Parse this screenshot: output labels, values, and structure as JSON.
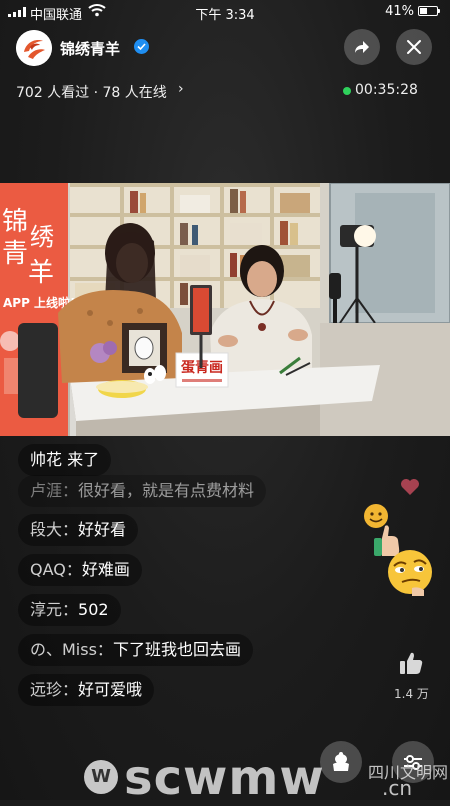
{
  "status_bar": {
    "carrier": "中国联通",
    "time": "下午 3:34",
    "battery_percent": "41%",
    "battery_level": 0.41
  },
  "header": {
    "channel_name": "锦绣青羊",
    "verified": true,
    "viewers_text": "702 人看过 · 78 人在线",
    "viewers_chevron": "›",
    "duration": "00:35:28",
    "live_color": "#2fd15c"
  },
  "video": {
    "banner_text": [
      "锦",
      "绣",
      "青",
      "羊"
    ],
    "banner_sub": "APP 上线啦!",
    "sign_text": "蛋青画"
  },
  "comments": [
    {
      "name": "",
      "text": "帅花 来了"
    },
    {
      "name": "卢涯：",
      "text": "很好看，就是有点费材料"
    },
    {
      "name": "段大：",
      "text": "好好看"
    },
    {
      "name": "QAQ：",
      "text": "好难画"
    },
    {
      "name": "淳元：",
      "text": "502"
    },
    {
      "name": "の、Miss：",
      "text": "下了班我也回去画"
    },
    {
      "name": "远珍：",
      "text": "好可爱哦"
    }
  ],
  "right_rail": {
    "like_count": "1.4 万",
    "icons": [
      "heart-icon",
      "thumbs-up-emoji-icon",
      "smug-emoji-icon",
      "like-icon",
      "gift-icon",
      "settings-icon"
    ]
  },
  "watermark": {
    "logo": "W",
    "text": "scwmw",
    "cn": "四川文明网",
    "tld": ".cn"
  }
}
